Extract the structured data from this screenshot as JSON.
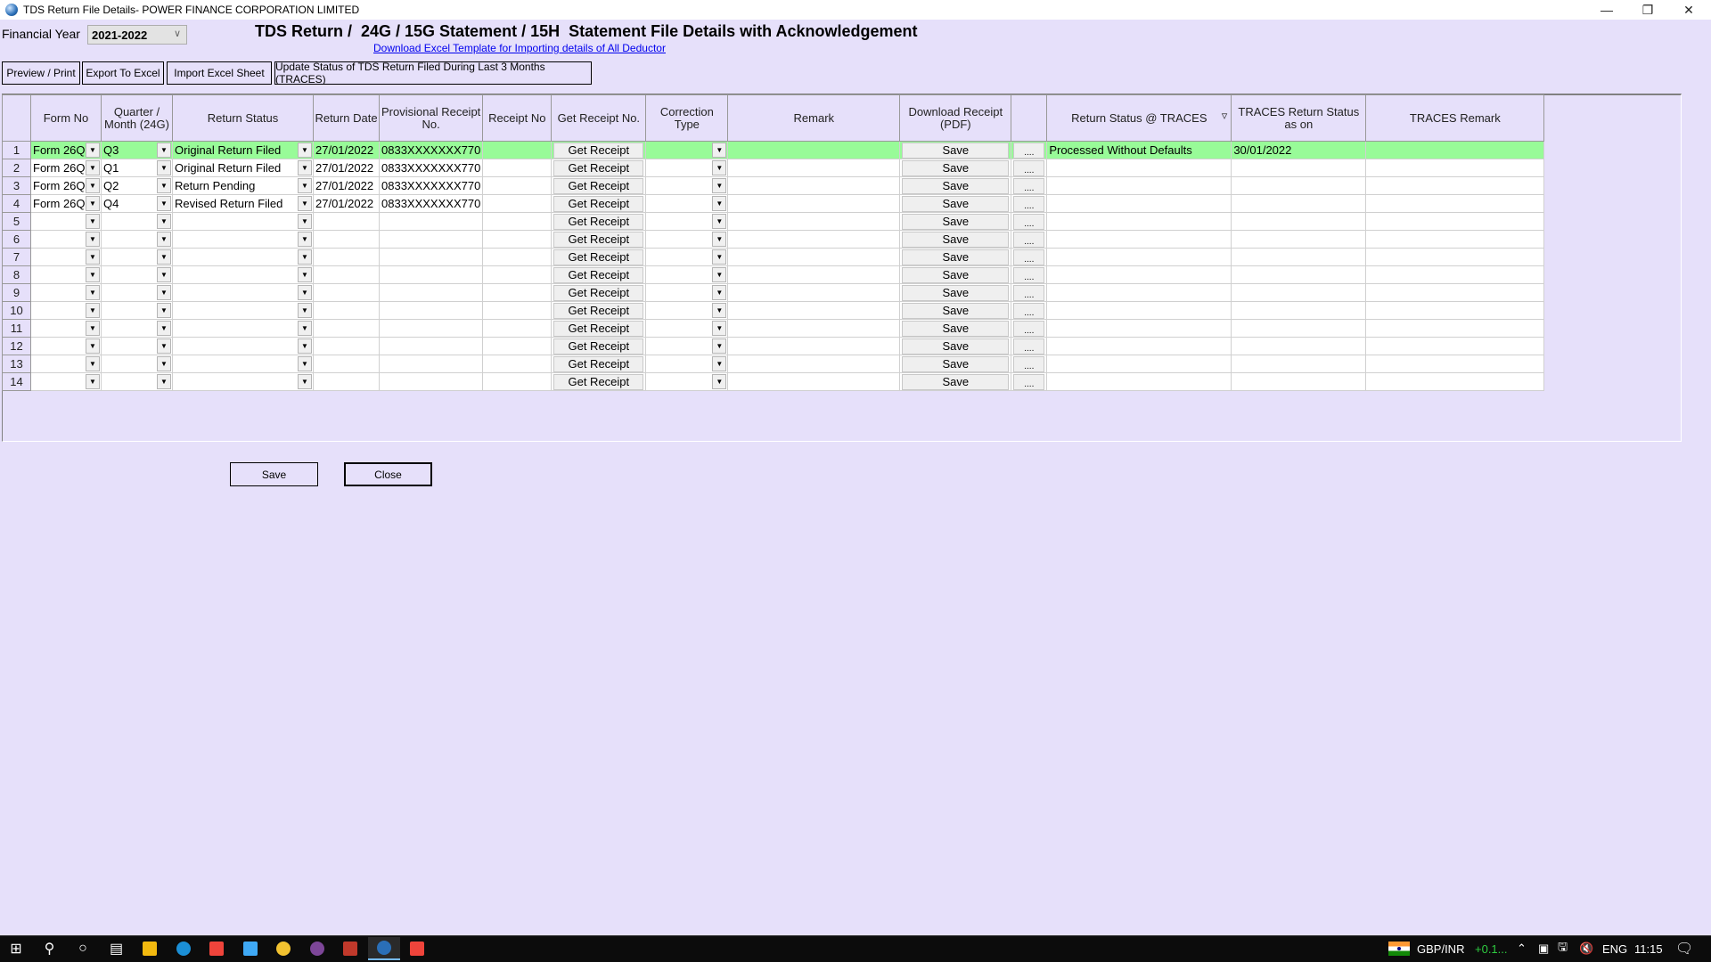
{
  "window": {
    "title": "TDS Return File Details- POWER FINANCE CORPORATION LIMITED",
    "controls": {
      "minimize": "—",
      "restore": "❐",
      "close": "✕"
    }
  },
  "header": {
    "fy_label": "Financial Year",
    "fy_value": "2021-2022",
    "title": "TDS Return /  24G / 15G Statement / 15H  Statement File Details with Acknowledgement",
    "download_link": "Download Excel Template for Importing details of All Deductor"
  },
  "toolbar": {
    "preview": "Preview / Print",
    "export": "Export To Excel",
    "import": "Import Excel Sheet",
    "update": "Update Status of TDS Return Filed During Last 3 Months (TRACES)"
  },
  "grid": {
    "columns": {
      "form_no": "Form No",
      "quarter": "Quarter / Month (24G)",
      "return_status": "Return Status",
      "return_date": "Return Date",
      "prov_receipt": "Provisional Receipt No.",
      "receipt_no": "Receipt No",
      "get_receipt": "Get Receipt No.",
      "correction_type": "Correction Type",
      "remark": "Remark",
      "download_receipt": "Download Receipt (PDF)",
      "dots": "",
      "traces_status": "Return Status @ TRACES",
      "traces_as_on": "TRACES Return Status as on",
      "traces_remark": "TRACES Remark"
    },
    "get_receipt_label": "Get Receipt",
    "save_label": "Save",
    "dots_label": "....",
    "highlight_color": "#98fb98",
    "rows": [
      {
        "n": "1",
        "form_no": "Form 26Q",
        "quarter": "Q3",
        "return_status": "Original Return Filed",
        "return_date": "27/01/2022",
        "prov_receipt": "0833XXXXXXX770",
        "receipt_no": "",
        "correction_type": "",
        "remark": "",
        "traces_status": "Processed Without Defaults",
        "traces_as_on": "30/01/2022",
        "traces_remark": "",
        "highlight": true
      },
      {
        "n": "2",
        "form_no": "Form 26Q",
        "quarter": "Q1",
        "return_status": "Original Return Filed",
        "return_date": "27/01/2022",
        "prov_receipt": "0833XXXXXXX770",
        "receipt_no": "",
        "correction_type": "",
        "remark": "",
        "traces_status": "",
        "traces_as_on": "",
        "traces_remark": ""
      },
      {
        "n": "3",
        "form_no": "Form 26Q",
        "quarter": "Q2",
        "return_status": "Return Pending",
        "return_date": "27/01/2022",
        "prov_receipt": "0833XXXXXXX770",
        "receipt_no": "",
        "correction_type": "",
        "remark": "",
        "traces_status": "",
        "traces_as_on": "",
        "traces_remark": ""
      },
      {
        "n": "4",
        "form_no": "Form 26Q",
        "quarter": "Q4",
        "return_status": "Revised Return Filed",
        "return_date": "27/01/2022",
        "prov_receipt": "0833XXXXXXX770",
        "receipt_no": "",
        "correction_type": "",
        "remark": "",
        "traces_status": "",
        "traces_as_on": "",
        "traces_remark": ""
      },
      {
        "n": "5"
      },
      {
        "n": "6"
      },
      {
        "n": "7"
      },
      {
        "n": "8"
      },
      {
        "n": "9"
      },
      {
        "n": "10"
      },
      {
        "n": "11"
      },
      {
        "n": "12"
      },
      {
        "n": "13"
      },
      {
        "n": "14"
      }
    ]
  },
  "footer": {
    "save": "Save",
    "close": "Close"
  },
  "taskbar": {
    "apps": [
      "start",
      "search",
      "cortana",
      "task-view",
      "notes-app",
      "edge",
      "anydesk",
      "remote-desktop",
      "chrome",
      "tor-browser",
      "accounting-app",
      "tds-app",
      "anydesk-2"
    ],
    "ticker_label": "GBP/INR",
    "ticker_change": "+0.1...",
    "language": "ENG",
    "time": "11:15"
  }
}
